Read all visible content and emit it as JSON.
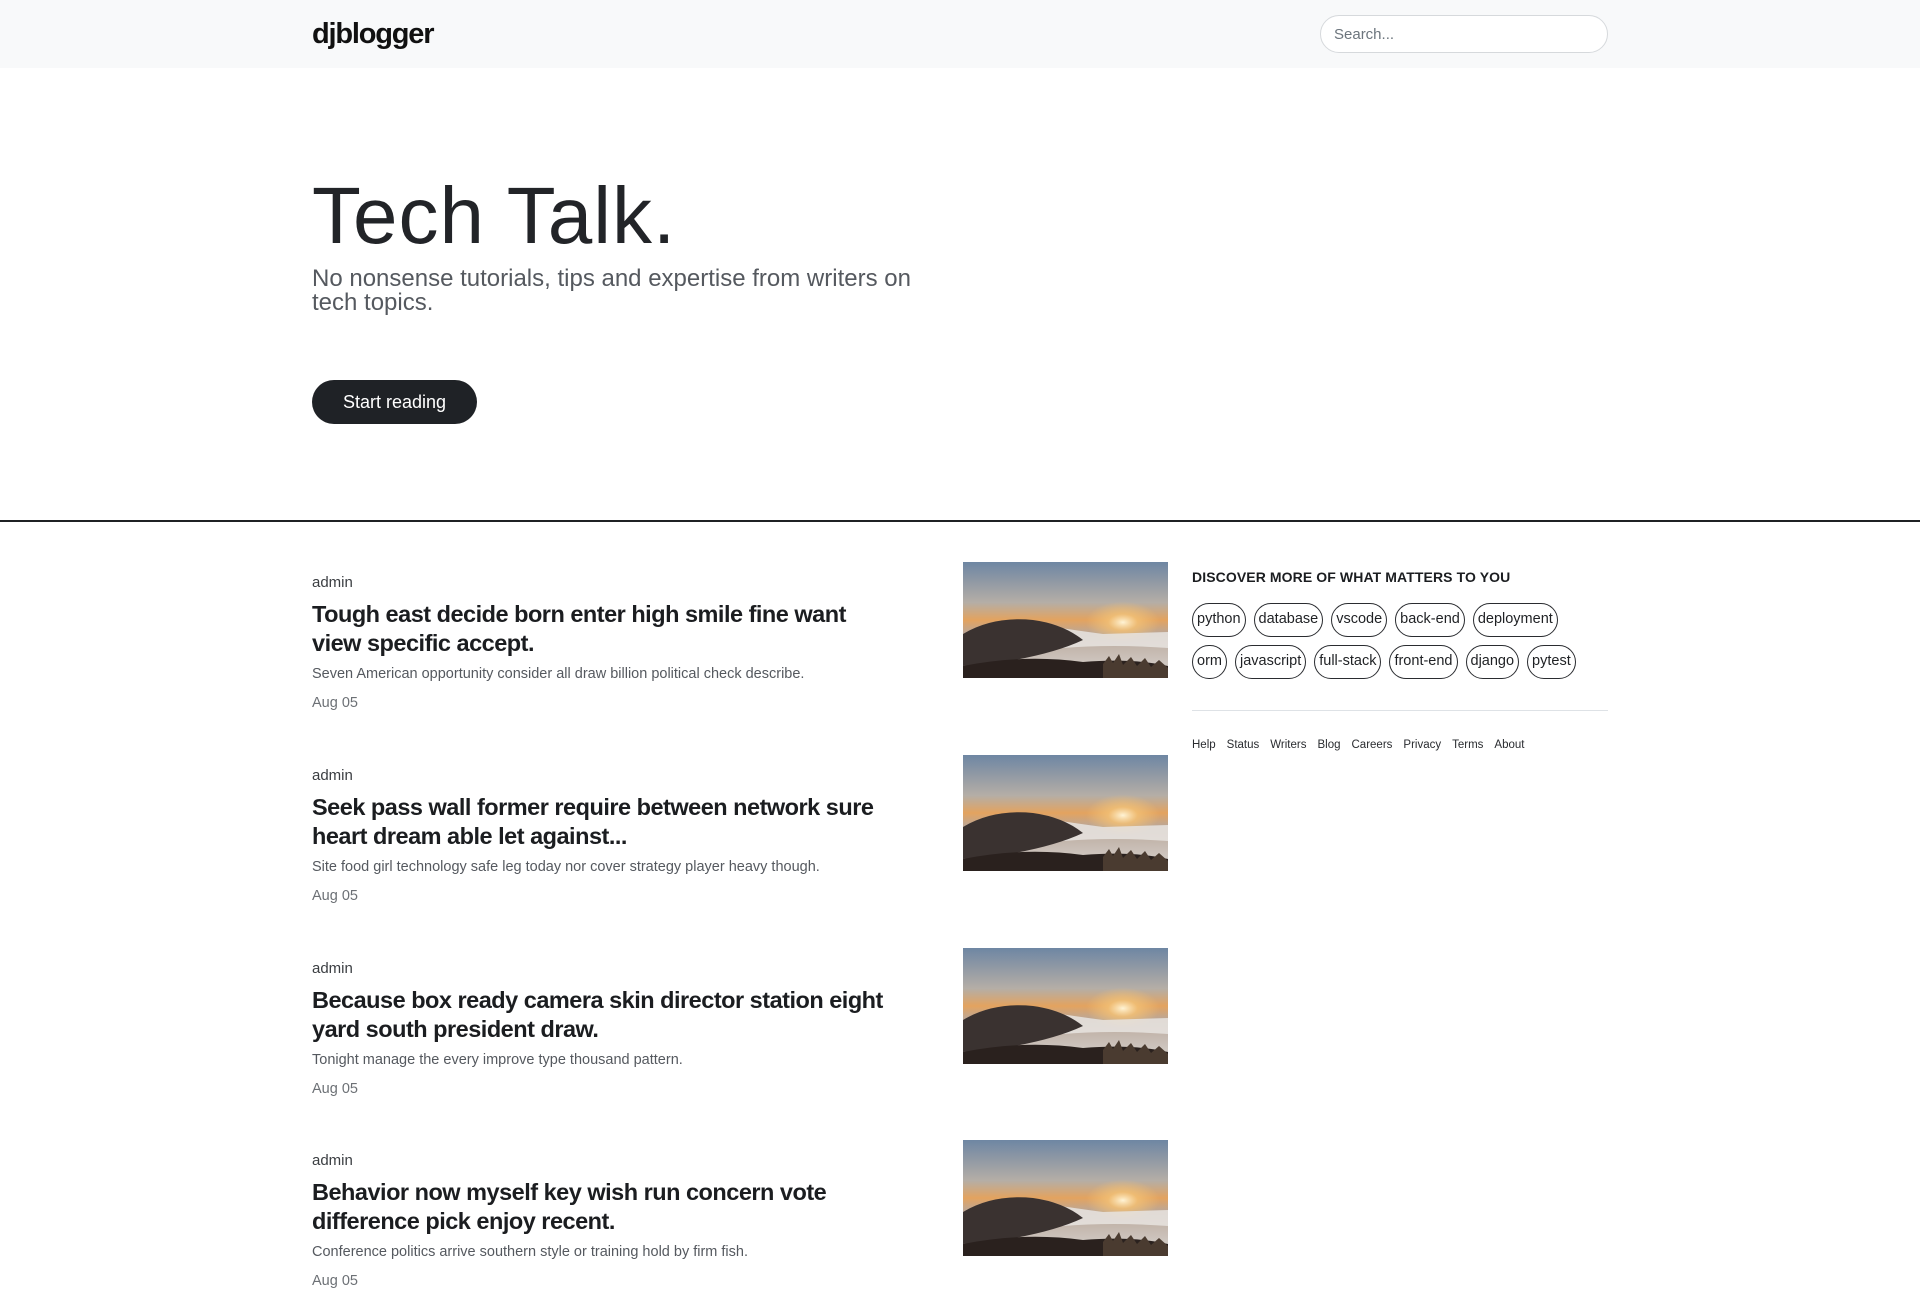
{
  "nav": {
    "logo": "djblogger",
    "search_placeholder": "Search..."
  },
  "hero": {
    "title": "Tech Talk.",
    "subtitle": "No nonsense tutorials, tips and expertise from writers on tech topics.",
    "cta_label": "Start reading"
  },
  "posts": [
    {
      "author": "admin",
      "title": "Tough east decide born enter high smile fine want view specific accept.",
      "excerpt": "Seven American opportunity consider all draw billion political check describe.",
      "date": "Aug 05",
      "thumbnail": "sunrise-over-fog-image"
    },
    {
      "author": "admin",
      "title": "Seek pass wall former require between network sure heart dream able let against...",
      "excerpt": "Site food girl technology safe leg today nor cover strategy player heavy though.",
      "date": "Aug 05",
      "thumbnail": "sunrise-over-fog-image"
    },
    {
      "author": "admin",
      "title": "Because box ready camera skin director station eight yard south president draw.",
      "excerpt": "Tonight manage the every improve type thousand pattern.",
      "date": "Aug 05",
      "thumbnail": "sunrise-over-fog-image"
    },
    {
      "author": "admin",
      "title": "Behavior now myself key wish run concern vote difference pick enjoy recent.",
      "excerpt": "Conference politics arrive southern style or training hold by firm fish.",
      "date": "Aug 05",
      "thumbnail": "sunrise-over-fog-image"
    }
  ],
  "sidebar": {
    "heading": "DISCOVER MORE OF WHAT MATTERS TO YOU",
    "tags_row1": [
      "python",
      "database",
      "vscode",
      "back-end",
      "deployment"
    ],
    "tags_row2": [
      "orm",
      "javascript",
      "full-stack",
      "front-end",
      "django",
      "pytest"
    ],
    "footer_links": [
      "Help",
      "Status",
      "Writers",
      "Blog",
      "Careers",
      "Privacy",
      "Terms",
      "About"
    ]
  },
  "colors": {
    "navbar_bg": "#f8f9fa",
    "button_bg": "#1f2226",
    "text_dark": "#1b1d20",
    "text_muted": "#55595f"
  }
}
